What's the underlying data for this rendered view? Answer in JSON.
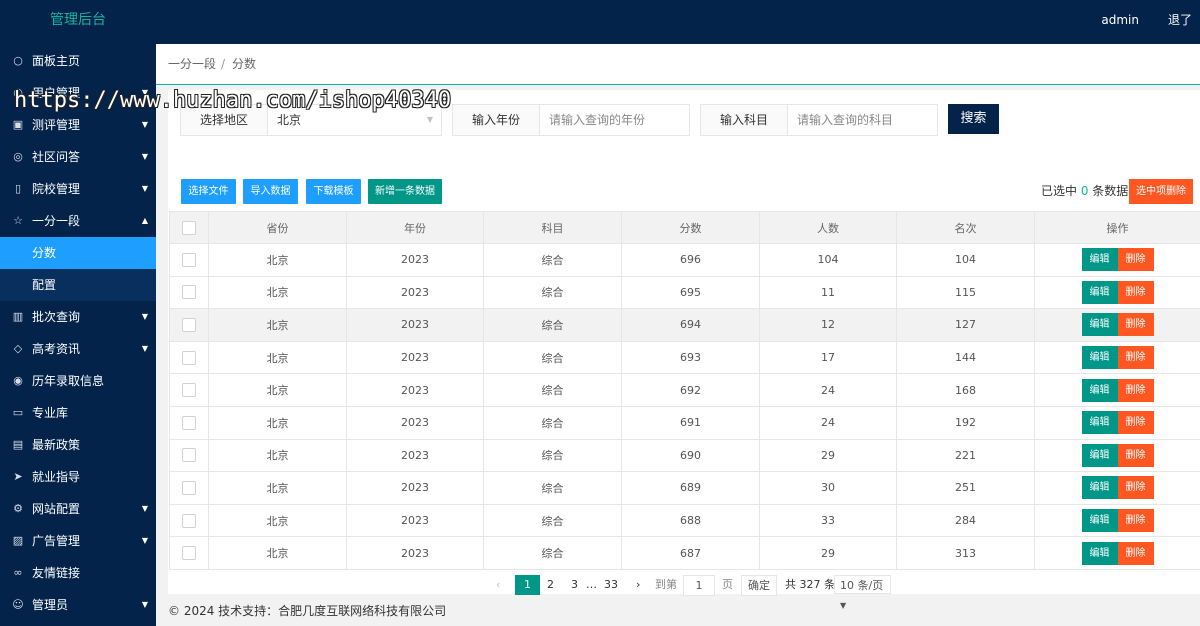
{
  "header": {
    "logo": "管理后台",
    "user": "admin",
    "logout": "退了"
  },
  "sidebar": {
    "items": [
      {
        "label": "面板主页",
        "icon": "○",
        "arrow": ""
      },
      {
        "label": "用户管理",
        "icon": "○",
        "arrow": "▼"
      },
      {
        "label": "测评管理",
        "icon": "▣",
        "arrow": "▼"
      },
      {
        "label": "社区问答",
        "icon": "◎",
        "arrow": "▼"
      },
      {
        "label": "院校管理",
        "icon": "▯",
        "arrow": "▼"
      },
      {
        "label": "一分一段",
        "icon": "☆",
        "arrow": "▲"
      },
      {
        "label": "分数",
        "icon": "",
        "arrow": ""
      },
      {
        "label": "配置",
        "icon": "",
        "arrow": ""
      },
      {
        "label": "批次查询",
        "icon": "▥",
        "arrow": "▼"
      },
      {
        "label": "高考资讯",
        "icon": "◇",
        "arrow": "▼"
      },
      {
        "label": "历年录取信息",
        "icon": "◉",
        "arrow": ""
      },
      {
        "label": "专业库",
        "icon": "▭",
        "arrow": ""
      },
      {
        "label": "最新政策",
        "icon": "▤",
        "arrow": ""
      },
      {
        "label": "就业指导",
        "icon": "➤",
        "arrow": ""
      },
      {
        "label": "网站配置",
        "icon": "⚙",
        "arrow": "▼"
      },
      {
        "label": "广告管理",
        "icon": "▨",
        "arrow": "▼"
      },
      {
        "label": "友情链接",
        "icon": "∞",
        "arrow": ""
      },
      {
        "label": "管理员",
        "icon": "☺",
        "arrow": "▼"
      }
    ]
  },
  "breadcrumb": {
    "parent": "一分一段",
    "sep": "/",
    "current": "分数"
  },
  "watermark": "https://www.huzhan.com/ishop40340",
  "search": {
    "region_label": "选择地区",
    "region_value": "北京",
    "year_label": "输入年份",
    "year_placeholder": "请输入查询的年份",
    "subject_label": "输入科目",
    "subject_placeholder": "请输入查询的科目",
    "search_button": "搜索"
  },
  "toolbar": {
    "choose_file": "选择文件",
    "import": "导入数据",
    "download_template": "下载模板",
    "add_new": "新增一条数据",
    "selected_prefix": "已选中 ",
    "selected_count": "0",
    "selected_suffix": " 条数据",
    "delete_selected": "选中项删除"
  },
  "table": {
    "headers": [
      "省份",
      "年份",
      "科目",
      "分数",
      "人数",
      "名次",
      "操作"
    ],
    "edit_label": "编辑",
    "delete_label": "删除",
    "rows": [
      [
        "北京",
        "2023",
        "综合",
        "696",
        "104",
        "104"
      ],
      [
        "北京",
        "2023",
        "综合",
        "695",
        "11",
        "115"
      ],
      [
        "北京",
        "2023",
        "综合",
        "694",
        "12",
        "127"
      ],
      [
        "北京",
        "2023",
        "综合",
        "693",
        "17",
        "144"
      ],
      [
        "北京",
        "2023",
        "综合",
        "692",
        "24",
        "168"
      ],
      [
        "北京",
        "2023",
        "综合",
        "691",
        "24",
        "192"
      ],
      [
        "北京",
        "2023",
        "综合",
        "690",
        "29",
        "221"
      ],
      [
        "北京",
        "2023",
        "综合",
        "689",
        "30",
        "251"
      ],
      [
        "北京",
        "2023",
        "综合",
        "688",
        "33",
        "284"
      ],
      [
        "北京",
        "2023",
        "综合",
        "687",
        "29",
        "313"
      ]
    ]
  },
  "pager": {
    "prev": "‹",
    "current": "1",
    "p2": "2",
    "p3": "3",
    "ellipsis": "…",
    "last": "33",
    "next": "›",
    "goto_label": "到第",
    "goto_value": "1",
    "page_label": "页",
    "confirm": "确定",
    "total": "共 327 条",
    "per_page": "10 条/页"
  },
  "footer": "© 2024 技术支持：合肥几度互联网络科技有限公司"
}
